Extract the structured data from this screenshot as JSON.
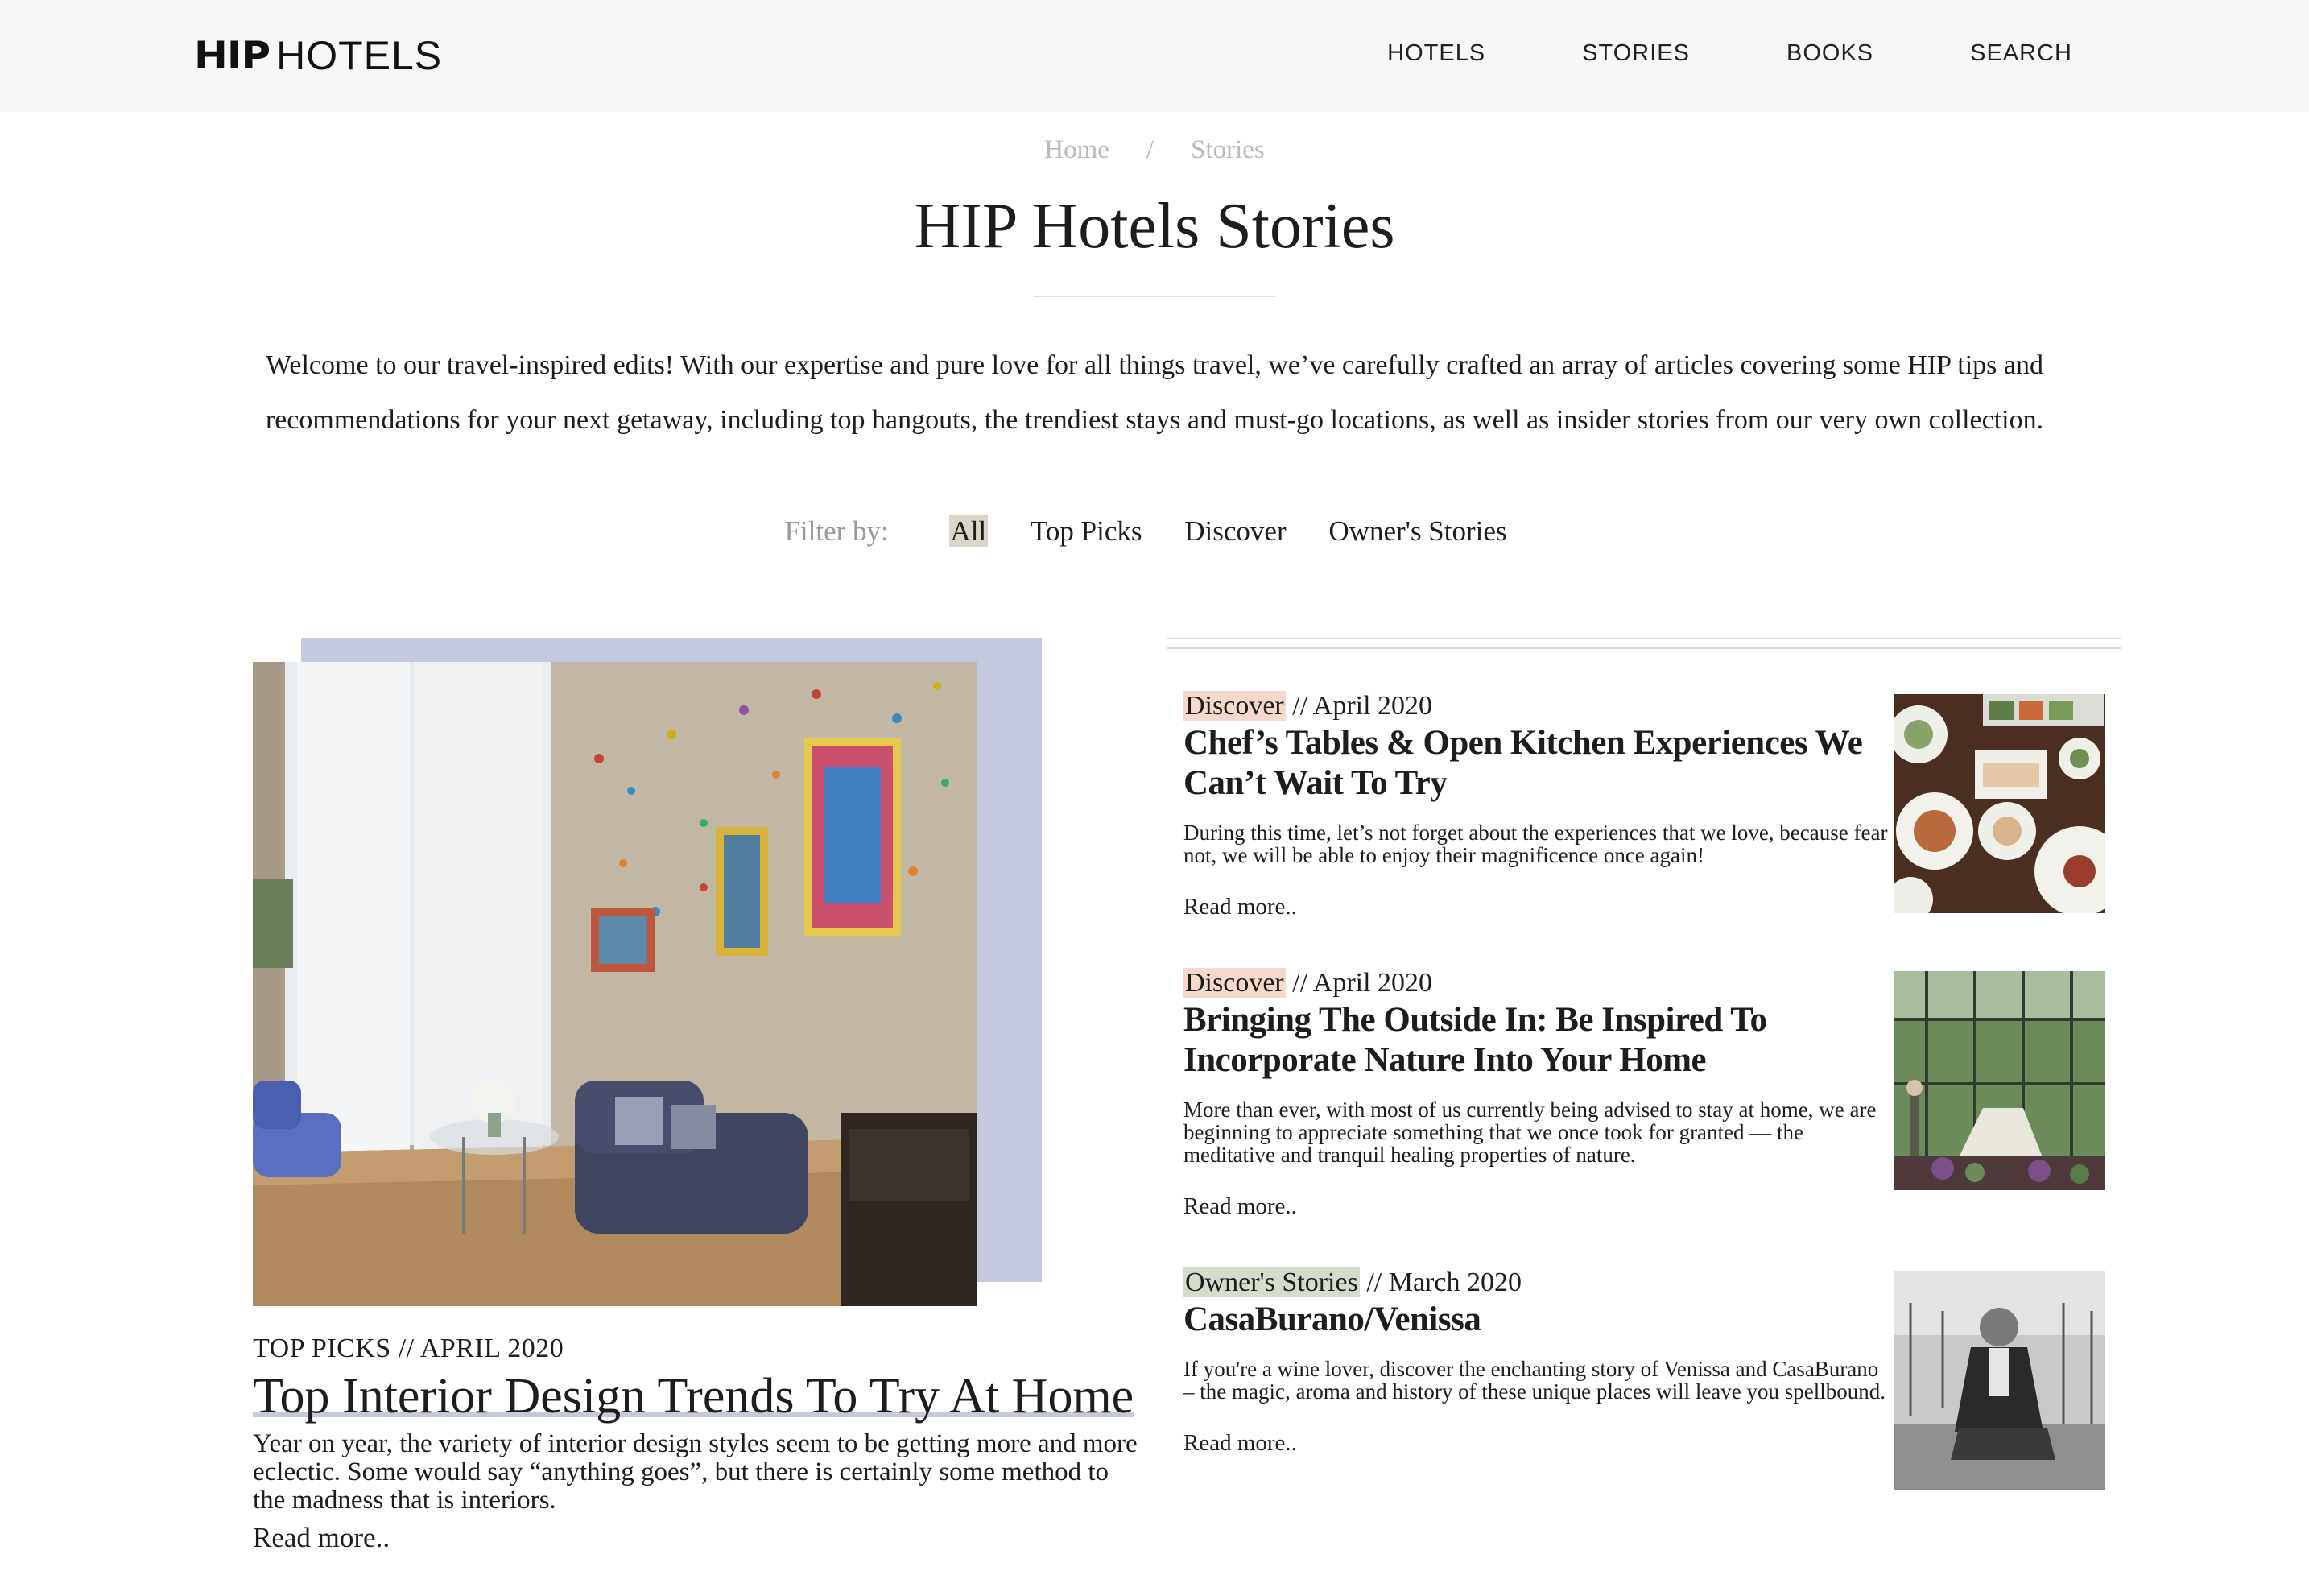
{
  "header": {
    "logo_bold": "HIP",
    "logo_light": "HOTELS",
    "nav": [
      "HOTELS",
      "STORIES",
      "BOOKS",
      "SEARCH"
    ]
  },
  "breadcrumb": {
    "home": "Home",
    "separator": "/",
    "current": "Stories"
  },
  "page": {
    "title": "HIP Hotels Stories",
    "intro": "Welcome to our travel-inspired edits! With our expertise and pure love for all things travel, we’ve carefully crafted an array of articles covering some HIP tips and recommendations for your next getaway, including top hangouts, the trendiest stays and must-go locations, as well as insider stories from our very own collection."
  },
  "filter": {
    "label": "Filter by:",
    "options": [
      "All",
      "Top Picks",
      "Discover",
      "Owner's Stories"
    ],
    "active": "All"
  },
  "featured": {
    "meta": "TOP PICKS // APRIL 2020",
    "title": "Top Interior Design Trends To Try At Home",
    "excerpt": "Year on year, the variety of interior design styles seem to be getting more and more eclectic. Some would say “anything goes”, but there is certainly some method to the madness that is interiors.",
    "read_more": "Read more..",
    "image": "living-room-interior-photo"
  },
  "articles": [
    {
      "tag": "Discover",
      "date": " // April 2020",
      "title": "Chef’s Tables & Open Kitchen Experiences We Can’t Wait To Try",
      "excerpt": "During this time, let’s not forget about the experiences that we love, because fear not, we will be able to enjoy their magnificence once again!",
      "read_more": "Read more..",
      "image": "food-table-photo"
    },
    {
      "tag": "Discover",
      "date": " // April 2020",
      "title": "Bringing The Outside In: Be Inspired To Incorporate Nature Into Your Home",
      "excerpt": "More than ever, with most of us currently being advised to stay at home, we are beginning to appreciate something that we once took for granted — the meditative and tranquil healing properties of nature.",
      "read_more": "Read more..",
      "image": "greenhouse-dining-photo"
    },
    {
      "tag": "Owner's Stories",
      "date": " // March 2020",
      "title": "CasaBurano/Venissa",
      "excerpt": "If you're a wine lover, discover the enchanting story of Venissa and CasaBurano – the magic, aroma and history of these unique places will leave you spellbound.",
      "read_more": "Read more..",
      "image": "vineyard-owner-portrait-photo"
    }
  ],
  "colors": {
    "header_bg": "#f7f7f7",
    "featured_accent": "#c5c9dd",
    "discover_tag": "#f4d9cc",
    "owner_tag": "#d5dccc",
    "active_filter": "#d9d6c9"
  }
}
